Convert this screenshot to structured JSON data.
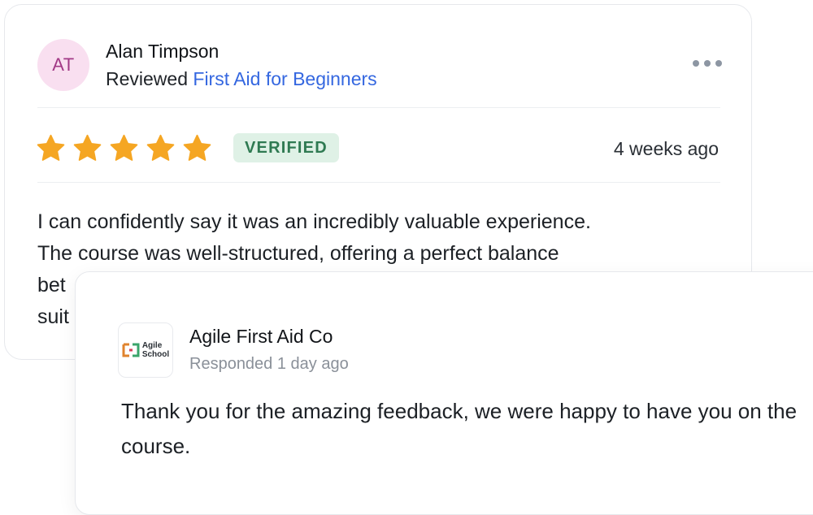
{
  "review": {
    "avatar_initials": "AT",
    "reviewer_name": "Alan Timpson",
    "reviewed_prefix": "Reviewed",
    "course_name": "First Aid for Beginners",
    "rating": 5,
    "rating_max": 5,
    "badge": "VERIFIED",
    "date": "4 weeks ago",
    "body": "I can confidently say it was an incredibly valuable experience. The course was well-structured, offering a perfect balance betw",
    "body_lines": [
      "I can confidently say it was an incredibly valuable experience.",
      "The course was well-structured, offering a perfect balance",
      "bet",
      "suit"
    ]
  },
  "response": {
    "logo_text_line1": "Agile",
    "logo_text_line2": "School",
    "company_name": "Agile First Aid Co",
    "time": "Responded 1 day ago",
    "body": "Thank you for the amazing feedback, we were happy to have you on the course."
  },
  "colors": {
    "accent": "#3467e0",
    "star": "#f5a623",
    "badge_bg": "#dff1e6",
    "badge_text": "#2f7a52",
    "avatar_bg": "#f9dff0",
    "avatar_text": "#a23a86"
  },
  "icons": {
    "more": "more-horizontal-icon",
    "star": "star-icon"
  }
}
